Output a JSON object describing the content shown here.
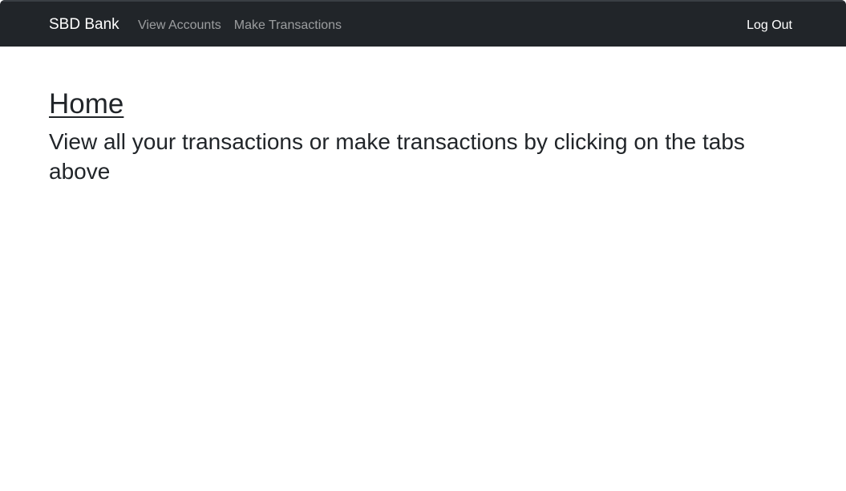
{
  "navbar": {
    "brand": "SBD Bank",
    "links": [
      {
        "label": "View Accounts"
      },
      {
        "label": "Make Transactions"
      }
    ],
    "logout_label": "Log Out",
    "background_color": "#212529"
  },
  "main": {
    "title": "Home",
    "subtitle": "View all your transactions or make transactions by clicking on the tabs above"
  }
}
